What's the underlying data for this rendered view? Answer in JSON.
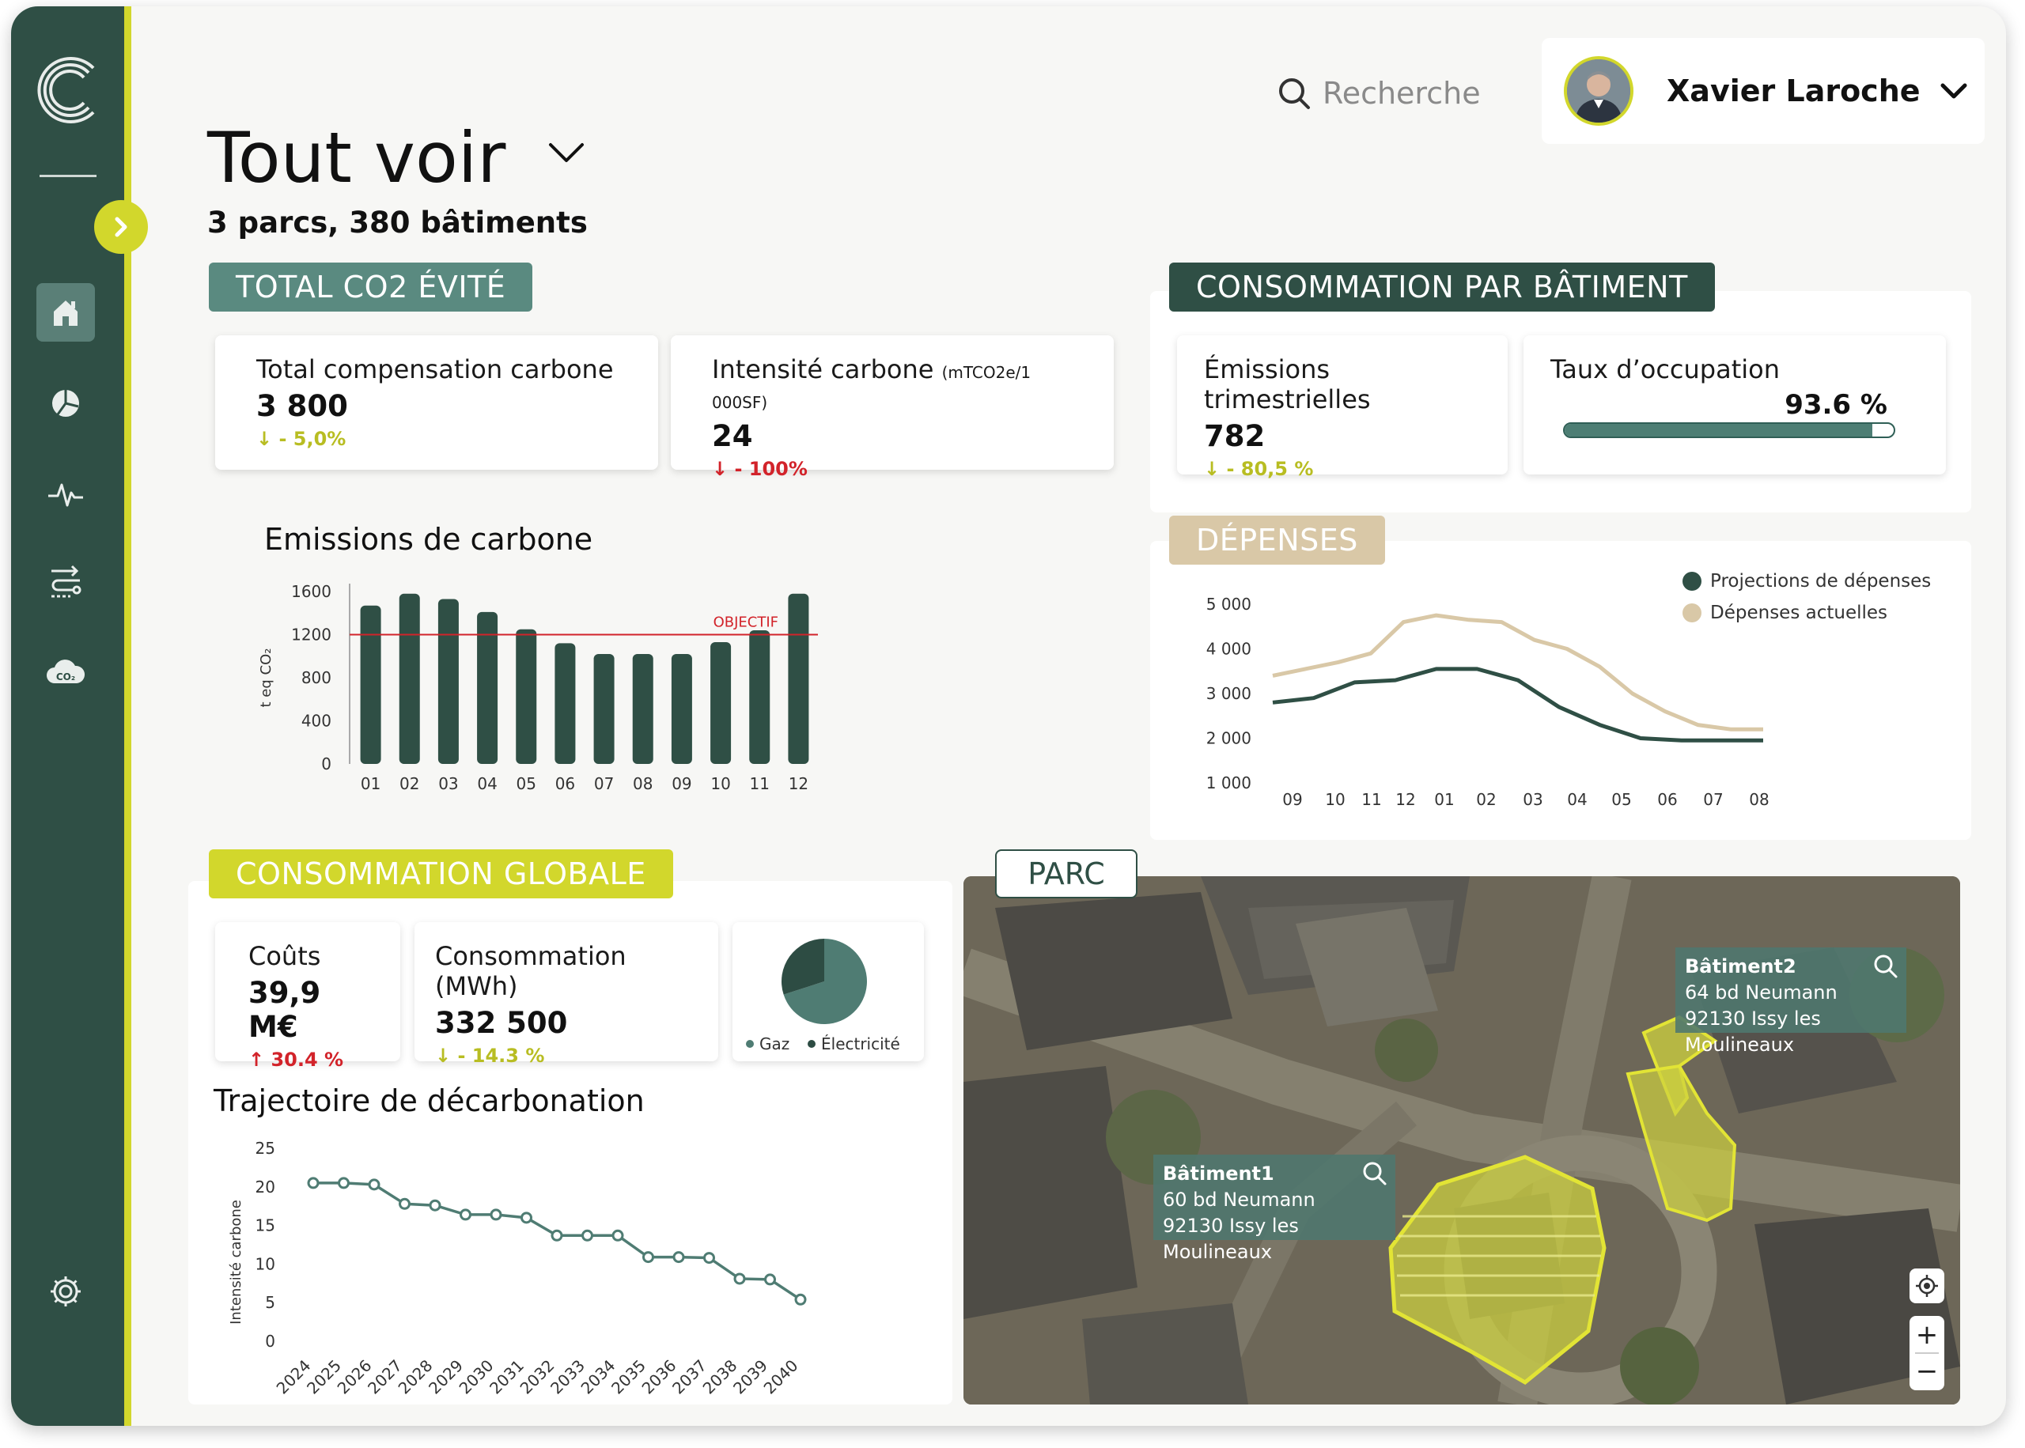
{
  "header": {
    "search_placeholder": "Recherche",
    "user_name": "Xavier Laroche",
    "title": "Tout voir",
    "subtitle": "3 parcs, 380 bâtiments"
  },
  "sidebar": {
    "items": [
      {
        "icon": "home-icon",
        "active": true
      },
      {
        "icon": "pie-chart-icon",
        "active": false
      },
      {
        "icon": "activity-icon",
        "active": false
      },
      {
        "icon": "flow-icon",
        "active": false
      },
      {
        "icon": "co2-cloud-icon",
        "active": false
      }
    ],
    "co2_label": "CO₂",
    "settings_icon": "gear-icon"
  },
  "co2": {
    "tag": "TOTAL CO2 ÉVITÉ",
    "card1": {
      "label": "Total compensation carbone",
      "value": "3 800",
      "delta": "↓ - 5,0%"
    },
    "card2": {
      "label": "Intensité carbone",
      "unit": "(mTCO2e/1 000SF)",
      "value": "24",
      "delta": "↓ - 100%"
    }
  },
  "building": {
    "tag": "CONSOMMATION PAR BÂTIMENT",
    "card1": {
      "label": "Émissions trimestrielles",
      "value": "782",
      "delta": "↓ - 80,5 %"
    },
    "card2": {
      "label": "Taux d’occupation",
      "value": "93.6 %",
      "fraction": 0.936
    }
  },
  "emissions_chart": {
    "title": "Emissions de carbone",
    "ylabel": "t eq CO₂",
    "objective_label": "OBJECTIF"
  },
  "depenses": {
    "tag": "DÉPENSES"
  },
  "globale": {
    "tag": "CONSOMMATION GLOBALE",
    "card1": {
      "label": "Coûts",
      "value": "39,9 M€",
      "delta": "↑ 30.4 %"
    },
    "card2": {
      "label": "Consommation (MWh)",
      "value": "332 500",
      "delta": "↓ - 14.3 %"
    }
  },
  "trajectory": {
    "title": "Trajectoire de décarbonation",
    "ylabel": "Intensité carbone"
  },
  "map": {
    "tag": "PARC",
    "building2": {
      "name": "Bâtiment2",
      "line1": "64 bd Neumann",
      "line2": "92130 Issy les Moulineaux"
    },
    "building1": {
      "name": "Bâtiment1",
      "line1": "60 bd Neumann",
      "line2": "92130 Issy les Moulineaux"
    },
    "zoom_in": "+",
    "zoom_out": "−"
  },
  "colors": {
    "sidebar": "#2f4f45",
    "accent_yellow": "#d2d72c",
    "dark_green": "#2f4f45",
    "teal": "#5a8a80",
    "beige": "#d9c8a7",
    "red": "#d2232a"
  },
  "chart_data": [
    {
      "type": "bar",
      "title": "Emissions de carbone",
      "ylabel": "t eq CO₂",
      "ylim": [
        0,
        1600
      ],
      "yticks": [
        0,
        400,
        800,
        1200,
        1600
      ],
      "categories": [
        "01",
        "02",
        "03",
        "04",
        "05",
        "06",
        "07",
        "08",
        "09",
        "10",
        "11",
        "12"
      ],
      "values": [
        1470,
        1580,
        1530,
        1410,
        1250,
        1120,
        1020,
        1020,
        1020,
        1130,
        1240,
        1580
      ],
      "reference_line": {
        "label": "OBJECTIF",
        "value": 1200
      }
    },
    {
      "type": "line",
      "categories": [
        "09",
        "10",
        "11",
        "12",
        "01",
        "02",
        "03",
        "04",
        "05",
        "06",
        "07",
        "08"
      ],
      "yticks": [
        1000,
        2000,
        3000,
        4000,
        5000
      ],
      "ytick_labels": [
        "1 000",
        "2 000",
        "3 000",
        "4 000",
        "5 000"
      ],
      "ylim": [
        1000,
        5000
      ],
      "legend_position": "top-right",
      "series": [
        {
          "name": "Projections de dépenses",
          "color": "#2f4f45",
          "values": [
            2800,
            2900,
            3250,
            3300,
            3550,
            3550,
            3300,
            2700,
            2300,
            2000,
            1950,
            1950,
            1950
          ]
        },
        {
          "name": "Dépenses actuelles",
          "color": "#d9c8a7",
          "values": [
            3400,
            3550,
            3700,
            3900,
            4600,
            4750,
            4650,
            4600,
            4200,
            4000,
            3600,
            3000,
            2600,
            2300,
            2200,
            2200
          ]
        }
      ]
    },
    {
      "type": "pie",
      "slices": [
        {
          "name": "Gaz",
          "value": 70,
          "color": "#4f7c73"
        },
        {
          "name": "Électricité",
          "value": 30,
          "color": "#2d4c43"
        }
      ]
    },
    {
      "type": "line",
      "title": "Trajectoire de décarbonation",
      "ylabel": "Intensité carbone",
      "ylim": [
        0,
        25
      ],
      "yticks": [
        0,
        5,
        10,
        15,
        20,
        25
      ],
      "x": [
        "2024",
        "2025",
        "2026",
        "2027",
        "2028",
        "2029",
        "2030",
        "2031",
        "2032",
        "2033",
        "2034",
        "2035",
        "2036",
        "2037",
        "2038",
        "2039",
        "2040"
      ],
      "values": [
        20.5,
        20.5,
        20.3,
        17.8,
        17.6,
        16.4,
        16.4,
        16.0,
        13.7,
        13.7,
        13.7,
        10.9,
        10.9,
        10.8,
        8.1,
        8.0,
        5.4
      ]
    }
  ]
}
